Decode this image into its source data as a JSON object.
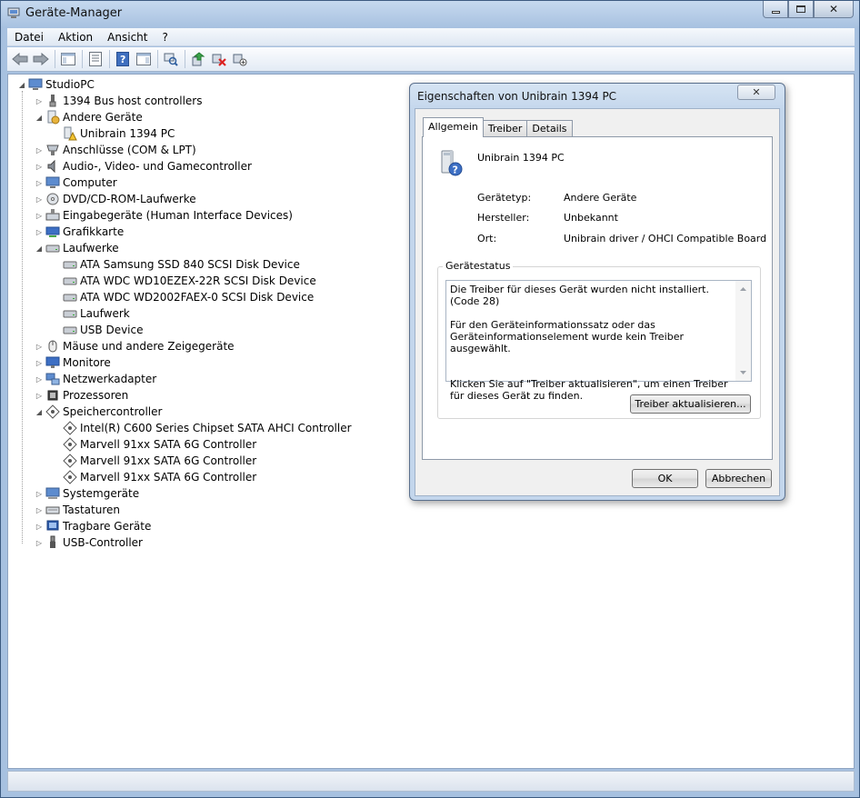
{
  "window": {
    "title": "Geräte-Manager",
    "minimize": "▭",
    "maximize": "▢",
    "close": "✕"
  },
  "menu": [
    "Datei",
    "Aktion",
    "Ansicht",
    "?"
  ],
  "tree": {
    "root": "StudioPC",
    "items": [
      {
        "label": "1394 Bus host controllers",
        "icon": "bus-icon",
        "expanded": false
      },
      {
        "label": "Andere Geräte",
        "icon": "unknown-device-icon",
        "expanded": true
      },
      {
        "label": "Unibrain 1394 PC",
        "icon": "warning-device-icon",
        "child": true
      },
      {
        "label": "Anschlüsse (COM & LPT)",
        "icon": "port-icon",
        "expanded": false
      },
      {
        "label": "Audio-, Video- und Gamecontroller",
        "icon": "speaker-icon",
        "expanded": false
      },
      {
        "label": "Computer",
        "icon": "computer-icon",
        "expanded": false
      },
      {
        "label": "DVD/CD-ROM-Laufwerke",
        "icon": "dvd-icon",
        "expanded": false
      },
      {
        "label": "Eingabegeräte (Human Interface Devices)",
        "icon": "hid-icon",
        "expanded": false
      },
      {
        "label": "Grafikkarte",
        "icon": "display-adapter-icon",
        "expanded": false
      },
      {
        "label": "Laufwerke",
        "icon": "disk-drive-icon",
        "expanded": true
      },
      {
        "label": "ATA Samsung SSD 840 SCSI Disk Device",
        "icon": "disk-icon",
        "child": true
      },
      {
        "label": "ATA WDC WD10EZEX-22R SCSI Disk Device",
        "icon": "disk-icon",
        "child": true
      },
      {
        "label": "ATA WDC WD2002FAEX-0 SCSI Disk Device",
        "icon": "disk-icon",
        "child": true
      },
      {
        "label": "Laufwerk",
        "icon": "disk-icon",
        "child": true
      },
      {
        "label": "USB Device",
        "icon": "disk-icon",
        "child": true
      },
      {
        "label": "Mäuse und andere Zeigegeräte",
        "icon": "mouse-icon",
        "expanded": false
      },
      {
        "label": "Monitore",
        "icon": "monitor-icon",
        "expanded": false
      },
      {
        "label": "Netzwerkadapter",
        "icon": "network-icon",
        "expanded": false
      },
      {
        "label": "Prozessoren",
        "icon": "processor-icon",
        "expanded": false
      },
      {
        "label": "Speichercontroller",
        "icon": "storage-controller-icon",
        "expanded": true
      },
      {
        "label": "Intel(R) C600 Series Chipset SATA AHCI Controller",
        "icon": "controller-icon",
        "child": true
      },
      {
        "label": "Marvell 91xx SATA 6G Controller",
        "icon": "controller-icon",
        "child": true
      },
      {
        "label": "Marvell 91xx SATA 6G Controller",
        "icon": "controller-icon",
        "child": true
      },
      {
        "label": "Marvell 91xx SATA 6G Controller",
        "icon": "controller-icon",
        "child": true
      },
      {
        "label": "Systemgeräte",
        "icon": "system-icon",
        "expanded": false
      },
      {
        "label": "Tastaturen",
        "icon": "keyboard-icon",
        "expanded": false
      },
      {
        "label": "Tragbare Geräte",
        "icon": "portable-icon",
        "expanded": false
      },
      {
        "label": "USB-Controller",
        "icon": "usb-icon",
        "expanded": false
      }
    ]
  },
  "dialog": {
    "title": "Eigenschaften von Unibrain 1394 PC",
    "close": "✕",
    "tabs": [
      "Allgemein",
      "Treiber",
      "Details"
    ],
    "device_name": "Unibrain 1394 PC",
    "props": [
      {
        "label": "Gerätetyp:",
        "value": "Andere Geräte"
      },
      {
        "label": "Hersteller:",
        "value": "Unbekannt"
      },
      {
        "label": "Ort:",
        "value": "Unibrain driver / OHCI Compatible Board"
      }
    ],
    "status_group": "Gerätestatus",
    "status_text": "Die Treiber für dieses Gerät wurden nicht installiert. (Code 28)\n\nFür den Geräteinformationssatz oder das\nGeräteinformationselement wurde kein Treiber ausgewählt.\n\n\nKlicken Sie auf \"Treiber aktualisieren\", um einen Treiber für dieses Gerät zu finden.",
    "update_button": "Treiber aktualisieren...",
    "ok": "OK",
    "cancel": "Abbrechen"
  }
}
